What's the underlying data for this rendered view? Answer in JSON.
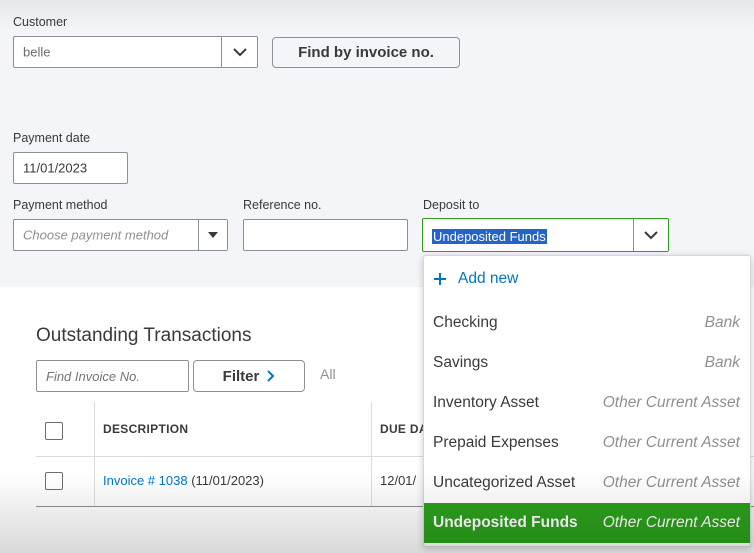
{
  "customer": {
    "label": "Customer",
    "value": "belle",
    "find_button": "Find by invoice no."
  },
  "payment_date": {
    "label": "Payment date",
    "value": "11/01/2023"
  },
  "payment_method": {
    "label": "Payment method",
    "placeholder": "Choose payment method"
  },
  "reference": {
    "label": "Reference no.",
    "value": ""
  },
  "deposit_to": {
    "label": "Deposit to",
    "value": "Undeposited Funds"
  },
  "outstanding": {
    "title": "Outstanding Transactions",
    "search_placeholder": "Find Invoice No.",
    "filter_label": "Filter",
    "all_label": "All",
    "columns": {
      "description": "DESCRIPTION",
      "due_date": "DUE DA"
    },
    "rows": [
      {
        "invoice_link": "Invoice # 1038",
        "invoice_date": "(11/01/2023)",
        "due_date": "12/01/"
      }
    ]
  },
  "deposit_menu": {
    "add_new": "Add new",
    "items": [
      {
        "name": "Checking",
        "type": "Bank"
      },
      {
        "name": "Savings",
        "type": "Bank"
      },
      {
        "name": "Inventory Asset",
        "type": "Other Current Asset"
      },
      {
        "name": "Prepaid Expenses",
        "type": "Other Current Asset"
      },
      {
        "name": "Uncategorized Asset",
        "type": "Other Current Asset"
      },
      {
        "name": "Undeposited Funds",
        "type": "Other Current Asset"
      }
    ],
    "selected_index": 5
  },
  "colors": {
    "accent_green": "#2ca01c",
    "link_blue": "#0077c5",
    "selection_blue": "#2563c9"
  },
  "icons": [
    "chevron-down-icon",
    "caret-down-icon",
    "plus-icon",
    "chevron-right-icon"
  ]
}
